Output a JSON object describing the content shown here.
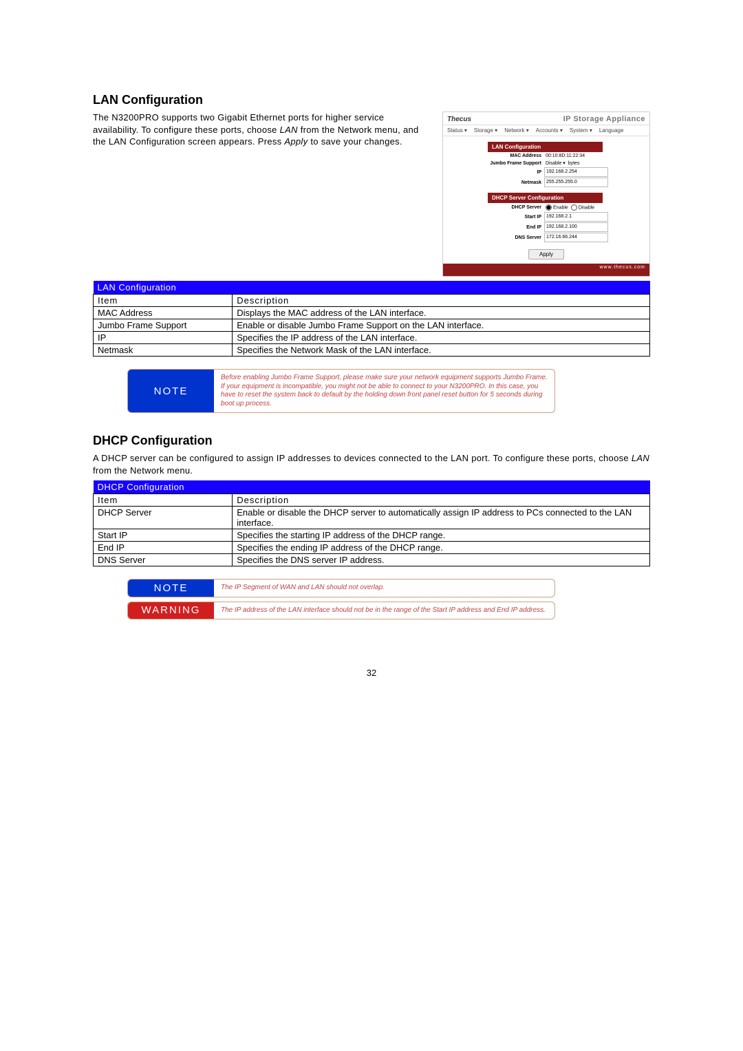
{
  "lan": {
    "heading": "LAN Configuration",
    "intro_parts": {
      "a": "The N3200PRO supports two Gigabit Ethernet ports for higher service availability. To configure these ports, choose ",
      "b": "LAN",
      "c": " from the Network menu, and the LAN Configuration screen appears. Press ",
      "d": "Apply",
      "e": " to save your changes."
    },
    "table_title": "LAN Configuration",
    "col_item": "Item",
    "col_desc": "Description",
    "rows": [
      {
        "item": "MAC Address",
        "desc": "Displays the MAC address of the LAN interface."
      },
      {
        "item": "Jumbo Frame Support",
        "desc": "Enable or disable Jumbo Frame Support on the LAN interface."
      },
      {
        "item": "IP",
        "desc": "Specifies the IP address of the LAN interface."
      },
      {
        "item": "Netmask",
        "desc": "Specifies the Network Mask of the LAN interface."
      }
    ],
    "note_label": "NOTE",
    "note_text": "Before enabling Jumbo Frame Support, please make sure your network equipment supports Jumbo Frame. If your equipment is incompatible, you might not be able to connect to your N3200PRO. In this case, you have to reset the system back to default by the holding down front panel reset button for 5 seconds during boot up process."
  },
  "dhcp": {
    "heading": "DHCP Configuration",
    "intro_parts": {
      "a": "A DHCP server can be configured to assign IP addresses to devices connected to the LAN port. To configure these ports, choose ",
      "b": "LAN",
      "c": " from the Network menu."
    },
    "table_title": "DHCP Configuration",
    "col_item": "Item",
    "col_desc": "Description",
    "rows": [
      {
        "item": "DHCP Server",
        "desc": "Enable or disable the DHCP server to automatically assign IP address to PCs connected to the LAN interface."
      },
      {
        "item": "Start IP",
        "desc": "Specifies the starting IP address of the DHCP range."
      },
      {
        "item": "End IP",
        "desc": "Specifies the ending IP address of the DHCP range."
      },
      {
        "item": "DNS Server",
        "desc": "Specifies the DNS server IP address."
      }
    ],
    "note_label": "NOTE",
    "note_text": "The IP Segment of WAN and LAN should not overlap.",
    "warn_label": "WARNING",
    "warn_text": "The IP address of the LAN interface should not be in the range of the Start IP address and End IP address."
  },
  "mini": {
    "logo": "Thecus",
    "app_title": "IP Storage Appliance",
    "menu": {
      "status": "Status ▾",
      "storage": "Storage ▾",
      "network": "Network ▾",
      "accounts": "Accounts ▾",
      "system": "System ▾",
      "language": "Language"
    },
    "sec_lan": "LAN Configuration",
    "mac_label": "MAC Address",
    "mac_value": "00:10:8D:11:22:34",
    "jumbo_label": "Jumbo Frame Support",
    "jumbo_value": "Disable",
    "jumbo_suffix": "bytes",
    "ip_label": "IP",
    "ip_value": "192.168.2.254",
    "netmask_label": "Netmask",
    "netmask_value": "255.255.255.0",
    "sec_dhcp": "DHCP Server Configuration",
    "dhcp_server_label": "DHCP Server",
    "dhcp_enable": "Enable",
    "dhcp_disable": "Disable",
    "start_ip_label": "Start IP",
    "start_ip_value": "192.168.2.1",
    "end_ip_label": "End IP",
    "end_ip_value": "192.168.2.100",
    "dns_label": "DNS Server",
    "dns_value": "172.16.66.244",
    "apply": "Apply",
    "footer": "www.thecus.com"
  },
  "page_number": "32"
}
